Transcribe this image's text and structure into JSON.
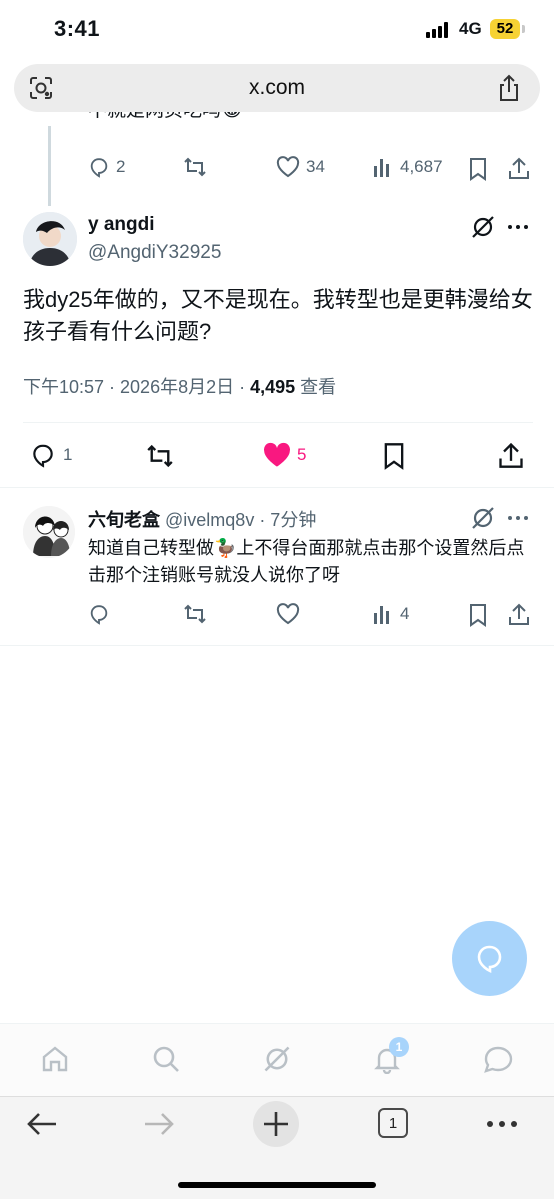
{
  "status_bar": {
    "time": "3:41",
    "network": "4G",
    "battery": "52"
  },
  "browser": {
    "url": "x.com",
    "tabs_count": "1"
  },
  "prev_tweet": {
    "text": "不就是网页吃吗😂",
    "replies": "2",
    "likes": "34",
    "views": "4,687"
  },
  "main_tweet": {
    "name": "y angdi",
    "handle": "@AngdiY32925",
    "text": "我dy25年做的，又不是现在。我转型也是更韩漫给女孩子看有什么问题?",
    "time": "下午10:57 · 2026年8月2日 · ",
    "views": "4,495",
    "views_label": " 查看",
    "replies": "1",
    "likes": "5",
    "liked_color": "#f91880"
  },
  "reply_tweet": {
    "name": "六旬老盒",
    "handle": "@ivelmq8v",
    "time": " · 7分钟",
    "text": "知道自己转型做🦆上不得台面那就点击那个设置然后点击那个注销账号就没人说你了呀",
    "views": "4"
  },
  "tabbar": {
    "notification_count": "1"
  },
  "colors": {
    "accent": "#1d9bf0",
    "fab": "#a8d4fb",
    "gray": "#536471"
  }
}
